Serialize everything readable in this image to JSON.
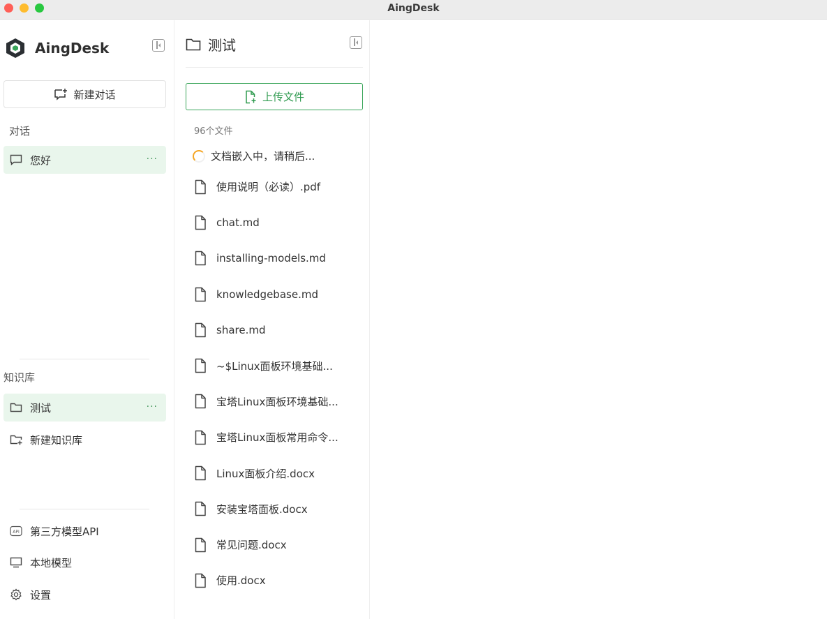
{
  "window": {
    "title": "AingDesk"
  },
  "sidebar": {
    "brand": "AingDesk",
    "new_chat_label": "新建对话",
    "conversations_label": "对话",
    "conversations": [
      {
        "label": "您好",
        "more": "···"
      }
    ],
    "knowledge_label": "知识库",
    "knowledge_bases": [
      {
        "label": "测试",
        "more": "···"
      }
    ],
    "new_kb_label": "新建知识库",
    "bottom": [
      {
        "label": "第三方模型API",
        "icon": "api-icon"
      },
      {
        "label": "本地模型",
        "icon": "monitor-icon"
      },
      {
        "label": "设置",
        "icon": "gear-icon"
      }
    ]
  },
  "filepanel": {
    "title": "测试",
    "upload_label": "上传文件",
    "file_count": "96个文件",
    "embedding_status": "文档嵌入中，请稍后...",
    "files": [
      "使用说明（必读）.pdf",
      "chat.md",
      "installing-models.md",
      "knowledgebase.md",
      "share.md",
      "~$Linux面板环境基础...",
      "宝塔Linux面板环境基础...",
      "宝塔Linux面板常用命令...",
      "Linux面板介绍.docx",
      "安装宝塔面板.docx",
      "常见问题.docx",
      "使用.docx"
    ]
  },
  "colors": {
    "accent": "#3aa55a",
    "active_bg": "#e9f6ec",
    "spinner": "#f5a623"
  }
}
